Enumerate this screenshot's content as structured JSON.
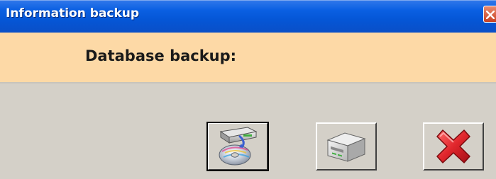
{
  "window": {
    "title": "Information backup"
  },
  "banner": {
    "label": "Database backup:"
  },
  "buttons": [
    {
      "name": "backup-to-disc-button",
      "icon": "drive-to-disc-icon"
    },
    {
      "name": "restore-button",
      "icon": "computer-drive-icon"
    },
    {
      "name": "cancel-button",
      "icon": "red-x-icon"
    }
  ],
  "colors": {
    "titlebar": "#0a5fe2",
    "banner": "#fdd9a6",
    "window": "#d4d0c8",
    "cancel_red": "#e0262c"
  }
}
